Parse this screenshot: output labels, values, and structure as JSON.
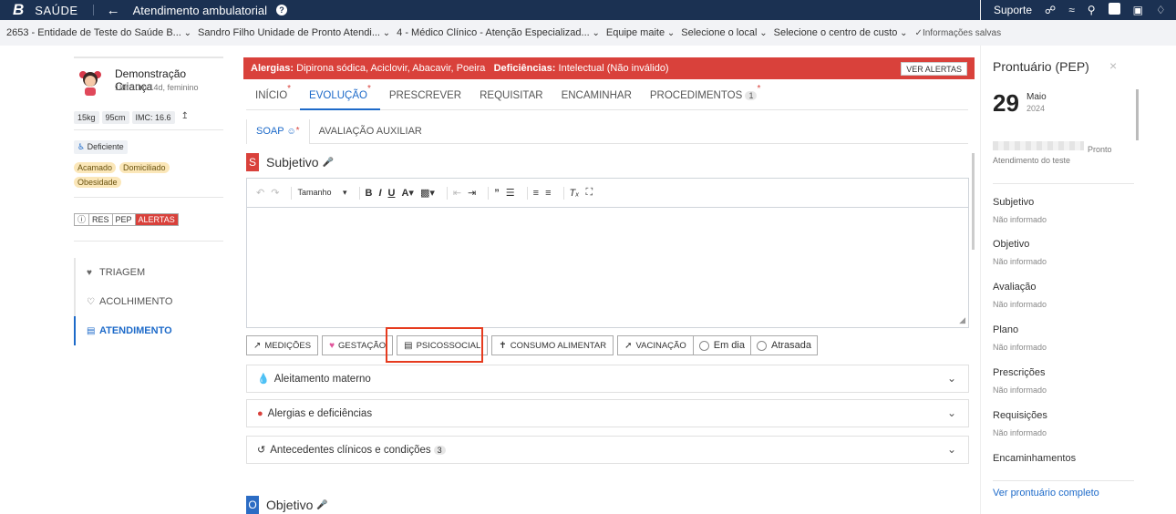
{
  "topbar": {
    "logo": "B",
    "brand": "SAÚDE",
    "title": "Atendimento ambulatorial",
    "help": "?",
    "support": "Suporte"
  },
  "context": {
    "items": [
      "2653 - Entidade de Teste do Saúde B...",
      "Sandro Filho Unidade de Pronto Atendi...",
      "4 - Médico Clínico - Atenção Especializad...",
      "Equipe maite",
      "Selecione o local",
      "Selecione o centro de custo"
    ],
    "saved": "Informações salvas"
  },
  "patient": {
    "name": "Demonstração Criança",
    "info": "18a 10m 14d, feminino",
    "weight": "15kg",
    "height": "95cm",
    "imc": "IMC: 16.6",
    "deficiency_tag": "Deficiente",
    "tags": [
      "Acamado",
      "Domiciliado",
      "Obesidade"
    ],
    "pills": [
      "RES",
      "PEP",
      "ALERTAS"
    ]
  },
  "nav": {
    "items": [
      {
        "label": "TRIAGEM",
        "icon": "heartbeat-icon"
      },
      {
        "label": "ACOLHIMENTO",
        "icon": "heart-icon"
      },
      {
        "label": "ATENDIMENTO",
        "icon": "clipboard-icon"
      }
    ]
  },
  "alert": {
    "allergies_label": "Alergias:",
    "allergies": "Dipirona sódica, Aciclovir, Abacavir, Poeira",
    "deficiencies_label": "Deficiências:",
    "deficiencies": "Intelectual (Não inválido)",
    "button": "VER ALERTAS"
  },
  "tabs": [
    {
      "label": "INÍCIO",
      "required": "*"
    },
    {
      "label": "EVOLUÇÃO",
      "required": "*"
    },
    {
      "label": "PRESCREVER"
    },
    {
      "label": "REQUISITAR"
    },
    {
      "label": "ENCAMINHAR"
    },
    {
      "label": "PROCEDIMENTOS",
      "count": "1",
      "required": "*"
    }
  ],
  "subtabs": [
    {
      "label": "SOAP",
      "required": "*"
    },
    {
      "label": "AVALIAÇÃO AUXILIAR"
    }
  ],
  "subjetivo": {
    "letter": "S",
    "title": "Subjetivo",
    "font_size_label": "Tamanho"
  },
  "toolbuttons": {
    "medicoes": "MEDIÇÕES",
    "gestacao": "GESTAÇÃO",
    "psicossocial": "PSICOSSOCIAL",
    "consumo": "CONSUMO ALIMENTAR",
    "vacinacao": "VACINAÇÃO",
    "em_dia": "Em dia",
    "atrasada": "Atrasada"
  },
  "accordions": [
    {
      "label": "Aleitamento materno"
    },
    {
      "label": "Alergias e deficiências"
    },
    {
      "label": "Antecedentes clínicos e condições",
      "count": "3"
    }
  ],
  "objetivo": {
    "letter": "O",
    "title": "Objetivo"
  },
  "record": {
    "title": "Prontuário (PEP)",
    "day": "29",
    "month": "Maio",
    "year": "2024",
    "location_suffix": "Pronto",
    "location_line": "Atendimento do teste",
    "sections": [
      {
        "title": "Subjetivo",
        "value": "Não informado"
      },
      {
        "title": "Objetivo",
        "value": "Não informado"
      },
      {
        "title": "Avaliação",
        "value": "Não informado"
      },
      {
        "title": "Plano",
        "value": "Não informado"
      },
      {
        "title": "Prescrições",
        "value": "Não informado"
      },
      {
        "title": "Requisições",
        "value": "Não informado"
      },
      {
        "title": "Encaminhamentos",
        "value": ""
      }
    ],
    "link": "Ver prontuário completo"
  },
  "colors": {
    "topbar": "#1b3152",
    "alert": "#d9413b",
    "accent": "#1d6ac9",
    "highlight": "#e63b1e"
  }
}
